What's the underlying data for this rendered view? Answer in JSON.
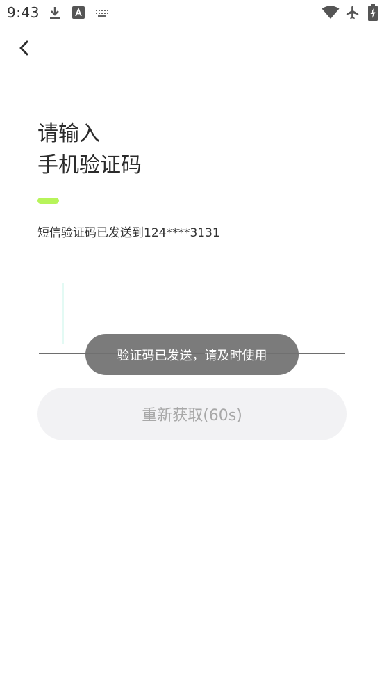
{
  "status_bar": {
    "time": "9:43",
    "icons": [
      "download-icon",
      "font-a-icon",
      "keyboard-icon",
      "wifi-icon",
      "airplane-icon",
      "battery-charging-icon"
    ]
  },
  "header": {
    "back_icon": "chevron-left-icon"
  },
  "main": {
    "title_line1": "请输入",
    "title_line2": "手机验证码",
    "subtitle": "短信验证码已发送到124****3131",
    "code_value": "",
    "resend_label": "重新获取(60s)"
  },
  "toast": {
    "message": "验证码已发送，请及时使用"
  },
  "colors": {
    "accent": "#b7f45a",
    "caret": "#e3faf4",
    "button_bg": "#f2f2f4",
    "toast_bg": "#707070"
  }
}
